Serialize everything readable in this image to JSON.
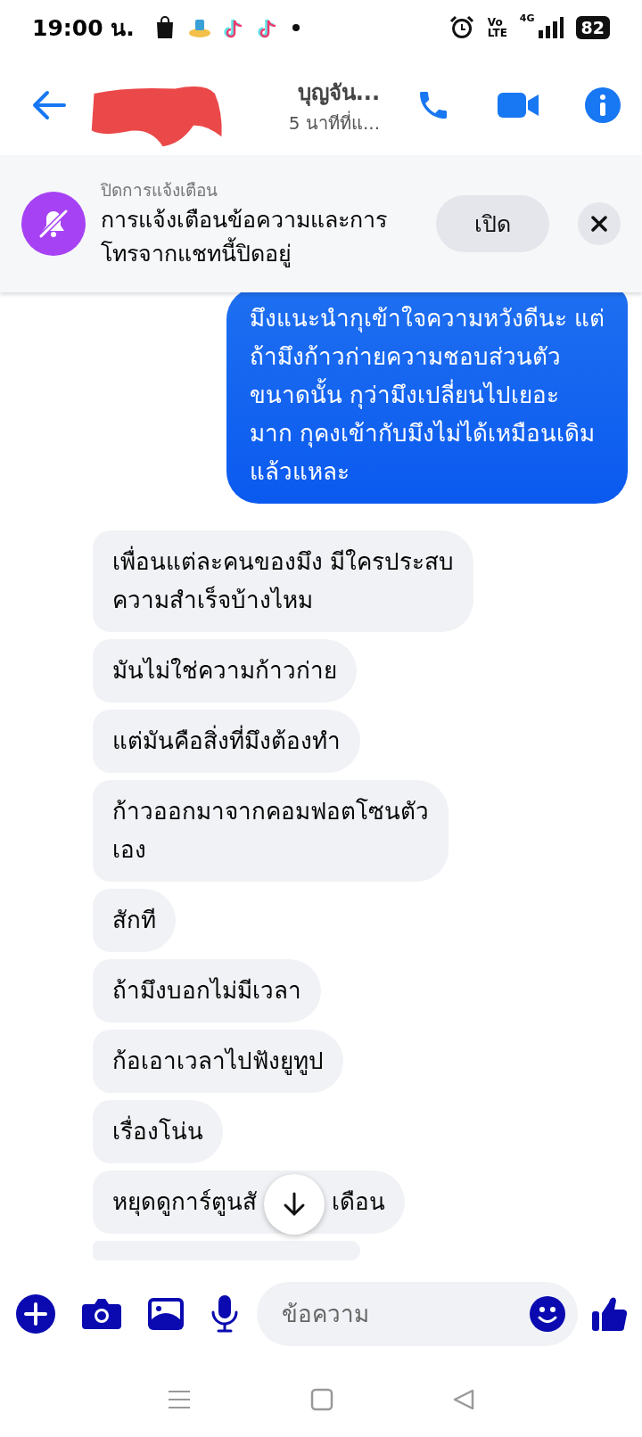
{
  "status_bar": {
    "time": "19:00 น.",
    "volte_top": "Vo",
    "volte_bottom": "LTE",
    "network": "4G",
    "battery": "82"
  },
  "header": {
    "title": "บุญจัน...",
    "subtitle": "5 นาทีที่แ..."
  },
  "banner": {
    "heading": "ปิดการแจ้งเตือน",
    "lines": [
      "การแจ้งเตือนข้อความและการ",
      "โทรจากแชทนี้ปิดอยู่"
    ],
    "button": "เปิด"
  },
  "messages": [
    {
      "kind": "outgoing",
      "lines": [
        "มึงแนะนำกุเข้าใจความหวังดีนะ แต่",
        "ถ้ามึงก้าวก่ายความชอบส่วนตัว",
        "ขนาดนั้น กุว่ามึงเปลี่ยนไปเยอะ",
        "มาก กุคงเข้ากับมึงไม่ได้เหมือนเดิม",
        "แล้วแหละ"
      ]
    },
    {
      "kind": "incoming",
      "lines": [
        "เพื่อนแต่ละคนของมึง มีใครประสบ",
        "ความสำเร็จบ้างไหม"
      ]
    },
    {
      "kind": "incoming",
      "lines": [
        "มันไม่ใช่ความก้าวก่าย"
      ]
    },
    {
      "kind": "incoming",
      "lines": [
        "แต่มันคือสิ่งที่มึงต้องทำ"
      ]
    },
    {
      "kind": "incoming",
      "lines": [
        "ก้าวออกมาจากคอมฟอตโซนตัว",
        "เอง"
      ]
    },
    {
      "kind": "incoming",
      "lines": [
        "สักที"
      ]
    },
    {
      "kind": "incoming",
      "lines": [
        "ถ้ามึงบอกไม่มีเวลา"
      ]
    },
    {
      "kind": "incoming",
      "lines": [
        "ก้อเอาเวลาไปฟังยูทูป"
      ]
    },
    {
      "kind": "incoming",
      "lines": [
        "เรื่องโน่น"
      ]
    },
    {
      "kind": "covered",
      "parts": [
        "หยุดดูการ์ตูนสั",
        "เดือน"
      ]
    },
    {
      "kind": "cut"
    }
  ],
  "composer": {
    "placeholder": "ข้อความ"
  }
}
